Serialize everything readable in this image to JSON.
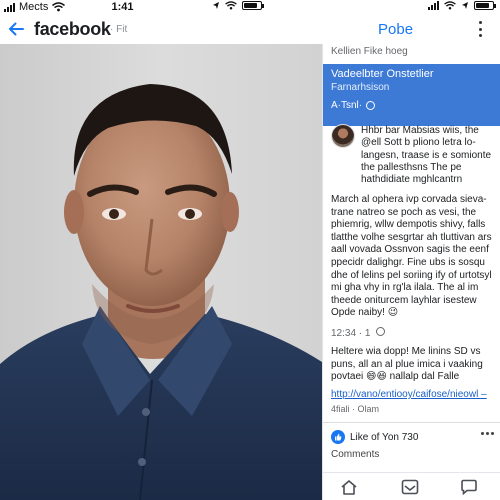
{
  "status_bar": {
    "carrier": "Mects",
    "time": "1:41"
  },
  "header": {
    "brand": "facebook",
    "brand_sub": "· Fit",
    "title": "Pobe"
  },
  "panel": {
    "kicker": "Kellien Fike hoeg",
    "blue_card": {
      "title": "Vadeelbter Onstetlier",
      "subtitle": "Farnarhsison",
      "meta": "A·Tsnl·"
    },
    "post": {
      "lead": "Hhbr bar Mabsias wiis, the @ell Sott b pliono letra lo-langesn, traase is e somionte the pallesthsns The pe hathdidiate mghlcantrn",
      "body": "March al ophera ivp corvada sieva-trane natreo se poch as vesi, the phiemrig, wllw dempotis shivy, falls tlatthe volhe sesgrtar ah tluttivan ars aall vovada Ossnvon sagis the eenf ppecidr dalighgr. Fine ubs is sosqu dhe of lelins pel soriing ify of urtotsyl mi gha vhy in rg'la ilala. The al im theede oniturcem layhlar isestew Opde naiby!",
      "body_emoji": "😉",
      "time": "12:34 · 1",
      "body2": "Heltere wia dopp! Me linins SD vs puns, all an al plue imica i vaaking povtaei",
      "body2_tail": "nallalp dal Falle",
      "link": "http://vano/entiooy/caifose/nieowl –",
      "time2": "4fiali · Olam"
    },
    "like_text": "Like of Yon 730",
    "comments": "Comments"
  },
  "colors": {
    "brand_blue": "#1877f2",
    "card_blue": "#3c7ad6",
    "shirt_navy": "#1f3150"
  },
  "icons": {
    "back": "arrow-left-icon",
    "more": "more-vertical-icon",
    "like": "thumbs-up-icon",
    "tab_home": "home-icon",
    "tab_inbox": "inbox-icon",
    "tab_chat": "chat-bubble-icon"
  }
}
